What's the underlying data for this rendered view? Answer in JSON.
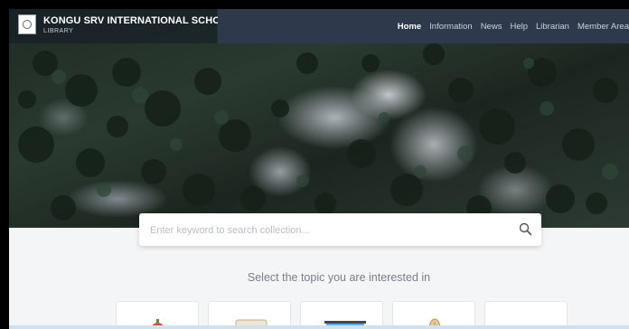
{
  "brand": {
    "name": "KONGU SRV INTERNATIONAL SCHOOL",
    "subtitle": "LIBRARY"
  },
  "nav": {
    "items": [
      {
        "label": "Home",
        "active": true
      },
      {
        "label": "Information",
        "active": false
      },
      {
        "label": "News",
        "active": false
      },
      {
        "label": "Help",
        "active": false
      },
      {
        "label": "Librarian",
        "active": false
      },
      {
        "label": "Member Area",
        "active": false
      }
    ]
  },
  "search": {
    "placeholder": "Enter keyword to search collection..."
  },
  "topics": {
    "heading": "Select the topic you are interested in",
    "icons": [
      "apple-icon",
      "scroll-icon",
      "projector-board-icon",
      "quill-icon",
      "more-dots-icon"
    ]
  },
  "colors": {
    "nav_bg": "#2e3a4c",
    "accent_red": "#e04a3f"
  }
}
